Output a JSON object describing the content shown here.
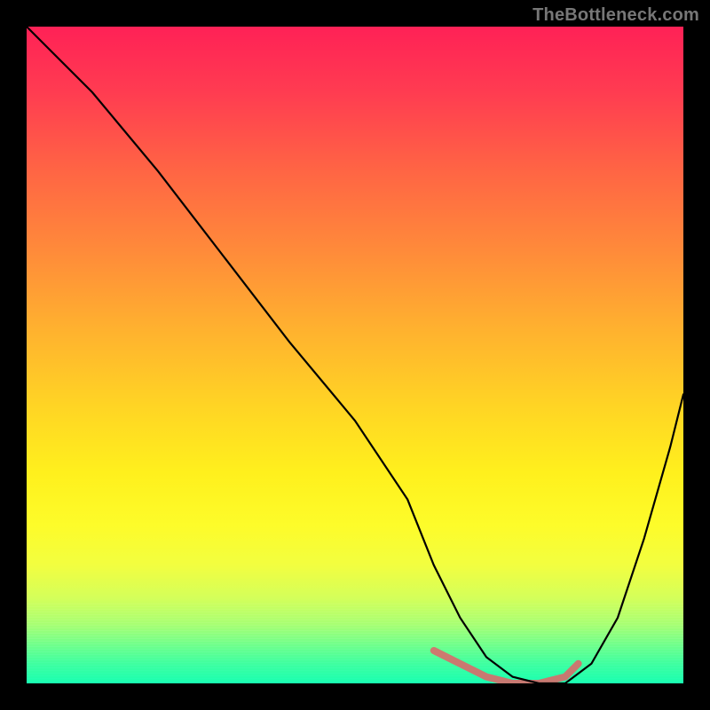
{
  "watermark": "TheBottleneck.com",
  "chart_data": {
    "type": "line",
    "title": "",
    "xlabel": "",
    "ylabel": "",
    "xlim": [
      0,
      100
    ],
    "ylim": [
      0,
      100
    ],
    "grid": false,
    "legend": false,
    "colors": {
      "gradient_top": "#ff2156",
      "gradient_mid": "#ffe126",
      "gradient_bottom": "#19ffb0",
      "curve": "#000000",
      "valley_highlight": "#d96a6a",
      "frame": "#000000"
    },
    "series": [
      {
        "name": "bottleneck-curve",
        "x": [
          0,
          4,
          10,
          20,
          30,
          40,
          50,
          58,
          62,
          66,
          70,
          74,
          78,
          82,
          86,
          90,
          94,
          98,
          100
        ],
        "y": [
          100,
          96,
          90,
          78,
          65,
          52,
          40,
          28,
          18,
          10,
          4,
          1,
          0,
          0,
          3,
          10,
          22,
          36,
          44
        ]
      }
    ],
    "highlight_region": {
      "name": "valley-flat",
      "x": [
        62,
        66,
        70,
        74,
        78,
        82,
        84
      ],
      "y": [
        5,
        3,
        1,
        0,
        0,
        1,
        3
      ]
    }
  }
}
